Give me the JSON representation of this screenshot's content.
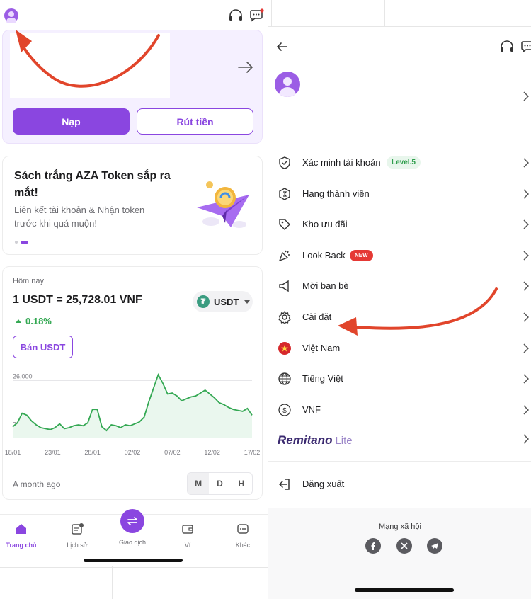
{
  "left": {
    "wallet": {
      "deposit_label": "Nạp",
      "withdraw_label": "Rút tiền"
    },
    "promo": {
      "title": "Sách trắng AZA Token sắp ra mắt!",
      "subtitle": "Liên kết tài khoản & Nhận token trước khi quá muộn!"
    },
    "market": {
      "today_label": "Hôm nay",
      "price_text": "1 USDT = 25,728.01 VNF",
      "change_text": "0.18%",
      "currency_code": "USDT",
      "sell_label": "Bán USDT",
      "range_label": "A month ago",
      "periods": [
        "M",
        "D",
        "H"
      ],
      "active_period": "M"
    },
    "nav": [
      {
        "label": "Trang chủ",
        "icon": "home-icon",
        "active": true
      },
      {
        "label": "Lịch sử",
        "icon": "history-icon",
        "active": false
      },
      {
        "label": "Giao dịch",
        "icon": "swap-icon",
        "active": false
      },
      {
        "label": "Ví",
        "icon": "wallet-icon",
        "active": false
      },
      {
        "label": "Khác",
        "icon": "more-icon",
        "active": false
      }
    ]
  },
  "chart_data": {
    "type": "area",
    "x": [
      "18/01",
      "23/01",
      "28/01",
      "02/02",
      "07/02",
      "12/02",
      "17/02"
    ],
    "y_ticks": [
      "26,000",
      "25,500"
    ],
    "ylim": [
      25400,
      26150
    ],
    "values": [
      25520,
      25560,
      25660,
      25640,
      25580,
      25540,
      25510,
      25500,
      25490,
      25510,
      25550,
      25500,
      25510,
      25530,
      25540,
      25530,
      25560,
      25700,
      25700,
      25520,
      25480,
      25540,
      25530,
      25510,
      25540,
      25530,
      25550,
      25570,
      25620,
      25780,
      25920,
      26060,
      25970,
      25860,
      25870,
      25840,
      25790,
      25810,
      25830,
      25840,
      25870,
      25900,
      25860,
      25820,
      25770,
      25750,
      25720,
      25700,
      25690,
      25680,
      25710,
      25640
    ],
    "line_color": "#34a853",
    "fill_color": "#eaf7ee"
  },
  "right": {
    "menu": [
      {
        "label": "Xác minh tài khoản",
        "icon": "shield-check-icon",
        "badge": "Level.5"
      },
      {
        "label": "Hạng thành viên",
        "icon": "member-rank-icon"
      },
      {
        "label": "Kho ưu đãi",
        "icon": "tag-icon"
      },
      {
        "label": "Look Back",
        "icon": "party-popper-icon",
        "badge": "NEW"
      },
      {
        "label": "Mời bạn bè",
        "icon": "megaphone-icon"
      },
      {
        "label": "Cài đặt",
        "icon": "gear-icon"
      },
      {
        "label": "Việt Nam",
        "icon": "vietnam-flag-icon"
      },
      {
        "label": "Tiếng Việt",
        "icon": "globe-icon"
      },
      {
        "label": "VNF",
        "icon": "dollar-circle-icon"
      }
    ],
    "brand": {
      "name": "Remitano",
      "suffix": "Lite"
    },
    "logout_label": "Đăng xuất",
    "social_title": "Mạng xã hội",
    "socials": [
      "facebook-icon",
      "x-icon",
      "telegram-icon"
    ]
  },
  "colors": {
    "accent": "#8a46e0",
    "positive": "#34a853",
    "annotation": "#e1452b"
  }
}
